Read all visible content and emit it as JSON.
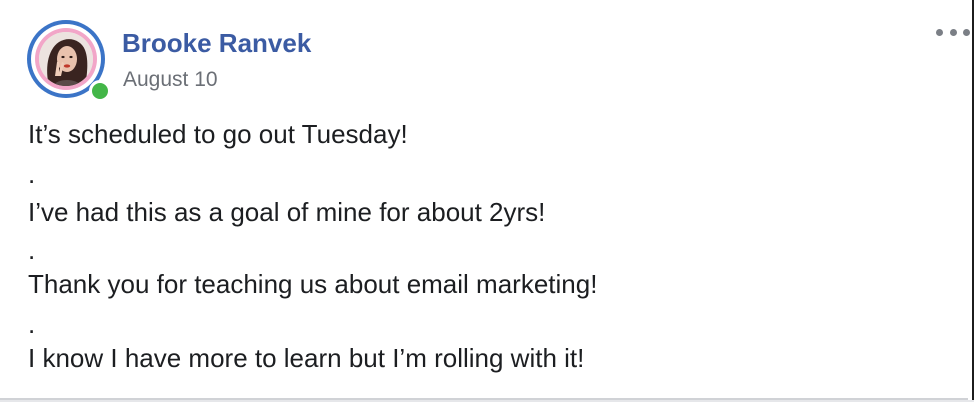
{
  "post": {
    "author_name": "Brooke Ranvek",
    "date": "August 10",
    "lines": [
      "It’s scheduled to go out Tuesday!",
      ".",
      "I’ve had this as a goal of mine for about 2yrs!",
      ".",
      "Thank you for teaching us about email marketing!",
      ".",
      "I know I have more to learn but I’m rolling with it!"
    ]
  },
  "icons": {
    "more": "more-options-icon",
    "online": "online-status-icon"
  },
  "colors": {
    "author_name": "#3b5ba3",
    "date": "#6b6f76",
    "ring_outer": "#3b74c7",
    "ring_pink": "#f2a6c8",
    "online": "#43b648",
    "body_text": "#1c1e21"
  }
}
